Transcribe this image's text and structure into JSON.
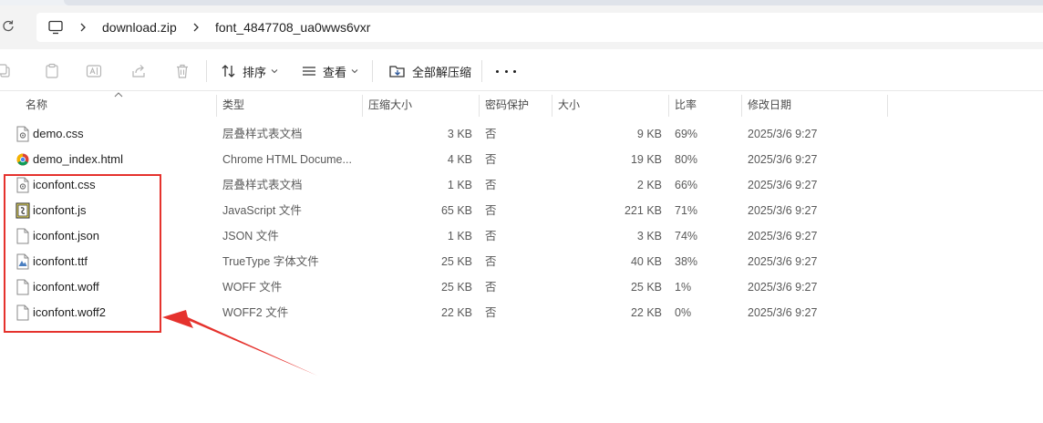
{
  "address_bar": {
    "crumbs": [
      "download.zip",
      "font_4847708_ua0wws6vxr"
    ]
  },
  "toolbar": {
    "sort_label": "排序",
    "view_label": "查看",
    "extract_label": "全部解压缩"
  },
  "columns": {
    "name": "名称",
    "type": "类型",
    "compressed": "压缩大小",
    "encrypted": "密码保护",
    "size": "大小",
    "ratio": "比率",
    "modified": "修改日期"
  },
  "files": [
    {
      "name": "demo.css",
      "type": "层叠样式表文档",
      "compressed": "3 KB",
      "encrypted": "否",
      "size": "9 KB",
      "ratio": "69%",
      "modified": "2025/3/6 9:27",
      "icon": "css-file-icon"
    },
    {
      "name": "demo_index.html",
      "type": "Chrome HTML Docume...",
      "compressed": "4 KB",
      "encrypted": "否",
      "size": "19 KB",
      "ratio": "80%",
      "modified": "2025/3/6 9:27",
      "icon": "chrome-html-icon"
    },
    {
      "name": "iconfont.css",
      "type": "层叠样式表文档",
      "compressed": "1 KB",
      "encrypted": "否",
      "size": "2 KB",
      "ratio": "66%",
      "modified": "2025/3/6 9:27",
      "icon": "css-file-icon"
    },
    {
      "name": "iconfont.js",
      "type": "JavaScript 文件",
      "compressed": "65 KB",
      "encrypted": "否",
      "size": "221 KB",
      "ratio": "71%",
      "modified": "2025/3/6 9:27",
      "icon": "js-file-icon"
    },
    {
      "name": "iconfont.json",
      "type": "JSON 文件",
      "compressed": "1 KB",
      "encrypted": "否",
      "size": "3 KB",
      "ratio": "74%",
      "modified": "2025/3/6 9:27",
      "icon": "blank-file-icon"
    },
    {
      "name": "iconfont.ttf",
      "type": "TrueType 字体文件",
      "compressed": "25 KB",
      "encrypted": "否",
      "size": "40 KB",
      "ratio": "38%",
      "modified": "2025/3/6 9:27",
      "icon": "font-file-icon"
    },
    {
      "name": "iconfont.woff",
      "type": "WOFF 文件",
      "compressed": "25 KB",
      "encrypted": "否",
      "size": "25 KB",
      "ratio": "1%",
      "modified": "2025/3/6 9:27",
      "icon": "blank-file-icon"
    },
    {
      "name": "iconfont.woff2",
      "type": "WOFF2 文件",
      "compressed": "22 KB",
      "encrypted": "否",
      "size": "22 KB",
      "ratio": "0%",
      "modified": "2025/3/6 9:27",
      "icon": "blank-file-icon"
    }
  ],
  "annotation": {
    "color": "#e5322d"
  },
  "colors": {
    "address_bg": "#f3f3f3",
    "icon_gray": "#a0a0a0",
    "extract_icon": "#2b579a"
  }
}
